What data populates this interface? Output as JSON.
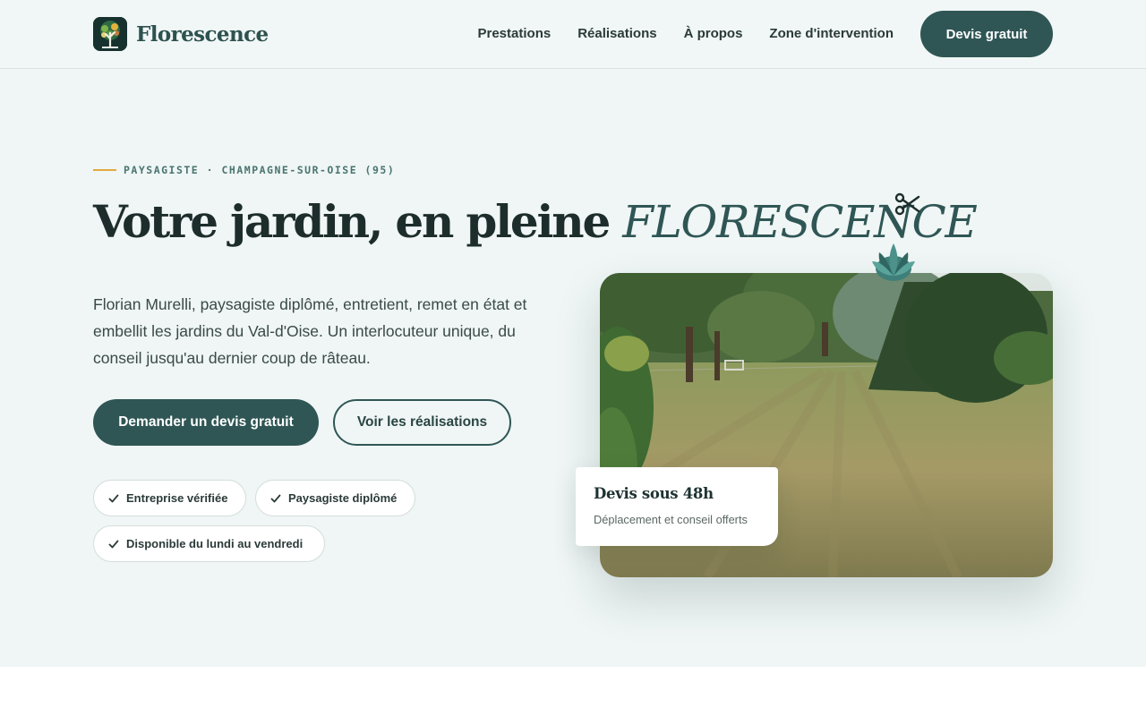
{
  "brand": {
    "name": "Florescence"
  },
  "nav": {
    "items": [
      {
        "label": "Prestations"
      },
      {
        "label": "Réalisations"
      },
      {
        "label": "À propos"
      },
      {
        "label": "Zone d'intervention"
      }
    ],
    "cta": "Devis gratuit"
  },
  "hero": {
    "eyebrow": "PAYSAGISTE · CHAMPAGNE-SUR-OISE (95)",
    "title_main": "Votre jardin, en pleine ",
    "title_accent": "FLORESCENCE",
    "lead": "Florian Murelli, paysagiste diplômé, entretient, remet en état et embellit les jardins du Val-d'Oise. Un interlocuteur unique, du conseil jusqu'au dernier coup de râteau.",
    "primary_cta": "Demander un devis gratuit",
    "secondary_cta": "Voir les réalisations",
    "badges": [
      {
        "label": "Entreprise vérifiée"
      },
      {
        "label": "Paysagiste diplômé"
      },
      {
        "label": "Disponible du lundi au vendredi"
      }
    ],
    "card": {
      "title": "Devis sous 48h",
      "subtitle": "Déplacement et conseil offerts"
    }
  },
  "colors": {
    "accent": "#2f5655",
    "hero_bg": "#eff6f5",
    "eyebrow_line": "#e4a93d"
  },
  "icons": [
    "tree-logo-icon",
    "check-icon",
    "scissors-icon",
    "flower-icon"
  ]
}
